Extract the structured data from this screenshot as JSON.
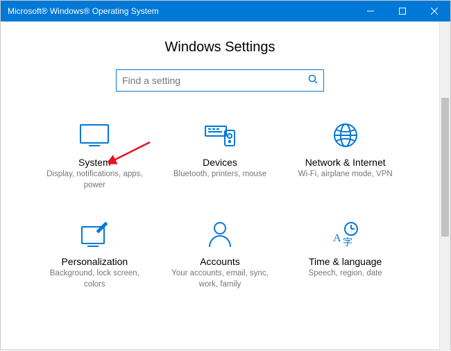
{
  "window": {
    "title": "Microsoft® Windows® Operating System"
  },
  "page": {
    "title": "Windows Settings"
  },
  "search": {
    "placeholder": "Find a setting"
  },
  "tiles": [
    {
      "title": "System",
      "desc": "Display, notifications, apps, power"
    },
    {
      "title": "Devices",
      "desc": "Bluetooth, printers, mouse"
    },
    {
      "title": "Network & Internet",
      "desc": "Wi-Fi, airplane mode, VPN"
    },
    {
      "title": "Personalization",
      "desc": "Background, lock screen, colors"
    },
    {
      "title": "Accounts",
      "desc": "Your accounts, email, sync, work, family"
    },
    {
      "title": "Time & language",
      "desc": "Speech, region, date"
    }
  ],
  "colors": {
    "accent": "#0078d7"
  },
  "annotation": {
    "arrow_points_to": "tile-system"
  }
}
